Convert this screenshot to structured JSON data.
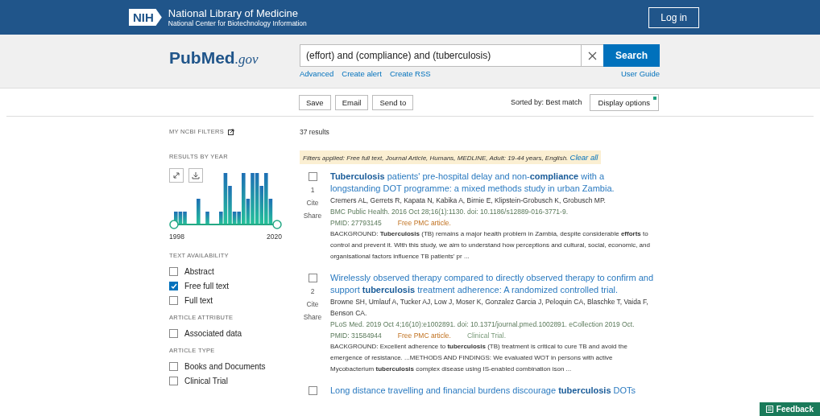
{
  "header": {
    "logo": "NIH",
    "title": "National Library of Medicine",
    "subtitle": "National Center for Biotechnology Information",
    "login": "Log in"
  },
  "search": {
    "brand_left": "Pub",
    "brand_right": "Med",
    "brand_suffix": ".gov",
    "value": "(effort) and (compliance) and (tuberculosis)",
    "button": "Search",
    "links": [
      "Advanced",
      "Create alert",
      "Create RSS"
    ],
    "guide": "User Guide"
  },
  "actions": {
    "buttons": [
      "Save",
      "Email",
      "Send to"
    ],
    "sort": "Sorted by: Best match",
    "display": "Display options"
  },
  "sidebar": {
    "my_filters": "MY NCBI FILTERS",
    "by_year": "RESULTS BY YEAR",
    "year_start": "1998",
    "year_end": "2020",
    "sections": [
      {
        "heading": "TEXT AVAILABILITY",
        "items": [
          {
            "label": "Abstract",
            "checked": false
          },
          {
            "label": "Free full text",
            "checked": true
          },
          {
            "label": "Full text",
            "checked": false
          }
        ]
      },
      {
        "heading": "ARTICLE ATTRIBUTE",
        "items": [
          {
            "label": "Associated data",
            "checked": false
          }
        ]
      },
      {
        "heading": "ARTICLE TYPE",
        "items": [
          {
            "label": "Books and Documents",
            "checked": false
          },
          {
            "label": "Clinical Trial",
            "checked": false
          }
        ]
      }
    ]
  },
  "results": {
    "count": "37 results",
    "filters": "Filters applied: Free full text, Journal Article, Humans, MEDLINE, Adult: 19-44 years, English.",
    "clear": "Clear all",
    "items": [
      {
        "number": "1",
        "cite": "Cite",
        "share": "Share",
        "checked": false,
        "title": "**Tuberculosis** patients' pre-hospital delay and non-**compliance** with a longstanding DOT programme: a mixed methods study in urban Zambia.",
        "authors": "Cremers AL, Gerrets R, Kapata N, Kabika A, Birnie E, Klipstein-Grobusch K, Grobusch MP.",
        "citation": "BMC Public Health. 2016 Oct 28;16(1):1130. doi: 10.1186/s12889-016-3771-9.",
        "pmid": "PMID: 27793145",
        "free": "Free PMC article.",
        "snippet": "BACKGROUND: **Tuberculosis** (TB) remains a major health problem in Zambia, despite considerable **efforts** to control and prevent it. With this study, we aim to understand how perceptions and cultural, social, economic, and organisational factors influence TB patients' pr ..."
      },
      {
        "number": "2",
        "cite": "Cite",
        "share": "Share",
        "checked": false,
        "title": "Wirelessly observed therapy compared to directly observed therapy to confirm and support **tuberculosis** treatment adherence: A randomized controlled trial.",
        "authors": "Browne SH, Umlauf A, Tucker AJ, Low J, Moser K, Gonzalez Garcia J, Peloquin CA, Blaschke T, Vaida F, Benson CA.",
        "citation": "PLoS Med. 2019 Oct 4;16(10):e1002891. doi: 10.1371/journal.pmed.1002891. eCollection 2019 Oct.",
        "pmid": "PMID: 31584944",
        "free": "Free PMC article.",
        "type": "Clinical Trial.",
        "snippet": "BACKGROUND: Excellent adherence to **tuberculosis** (TB) treatment is critical to cure TB and avoid the emergence of resistance. ...METHODS AND FINDINGS: We evaluated WOT in persons with active Mycobacterium **tuberculosis** complex disease using IS-enabled combination ison ..."
      },
      {
        "checked": false,
        "title": "Long distance travelling and financial burdens discourage **tuberculosis** DOTs"
      }
    ]
  },
  "feedback": "Feedback"
}
